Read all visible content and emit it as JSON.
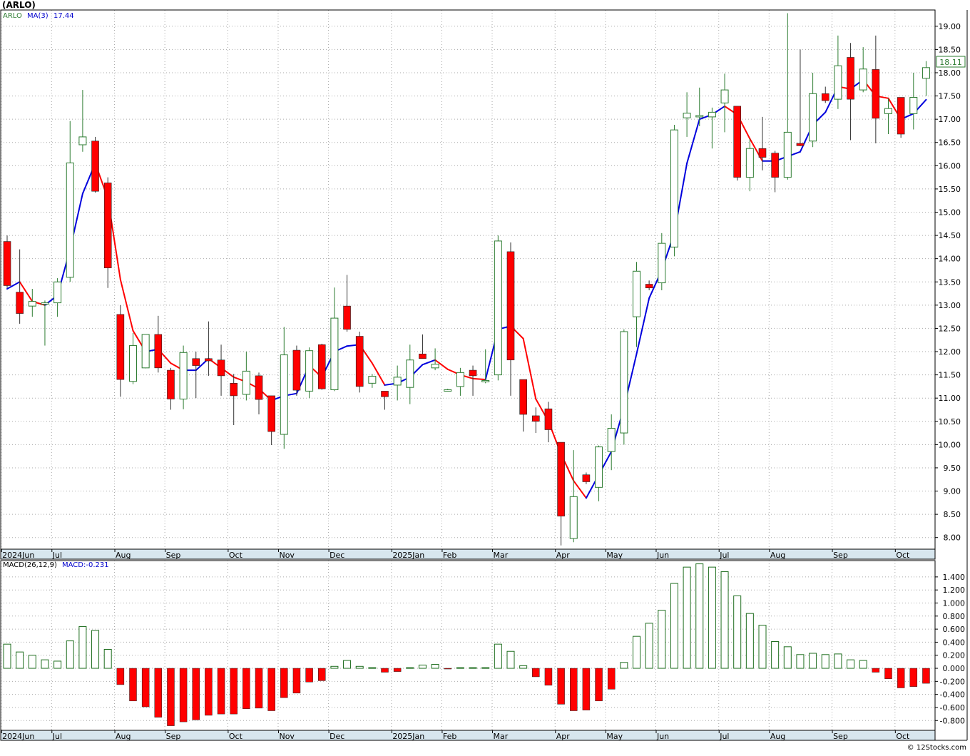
{
  "title": "(ARLO)",
  "legend": {
    "symbol": "ARLO",
    "ma_label": "MA(3)",
    "ma_value": "17.44",
    "macd_params": "MACD(26,12,9)",
    "macd_value": "MACD:-0.231"
  },
  "last_price_badge": "18.11",
  "credit": "© 12Stocks.com",
  "colors": {
    "up_candle": "#2e7d32",
    "down_candle": "#ff0000",
    "ma_up": "#0000dd",
    "ma_down": "#ff0000",
    "macd_pos": "#1f6e1f",
    "macd_neg": "#ff0000",
    "axis_band": "#d7e6ee",
    "grid": "#aaaaaa"
  },
  "chart_data": [
    {
      "type": "candlestick",
      "frequency": "weekly",
      "ylim": [
        7.75,
        19.35
      ],
      "yticks": [
        "19.00",
        "18.50",
        "18.00",
        "17.50",
        "17.00",
        "16.50",
        "16.00",
        "15.50",
        "15.00",
        "14.50",
        "14.00",
        "13.50",
        "13.00",
        "12.50",
        "12.00",
        "11.50",
        "11.00",
        "10.50",
        "10.00",
        "9.50",
        "9.00",
        "8.50",
        "8.00"
      ],
      "x_labels": [
        {
          "label": "2024Jun",
          "index": 0
        },
        {
          "label": "Jul",
          "index": 4
        },
        {
          "label": "Aug",
          "index": 9
        },
        {
          "label": "Sep",
          "index": 13
        },
        {
          "label": "Oct",
          "index": 18
        },
        {
          "label": "Nov",
          "index": 22
        },
        {
          "label": "Dec",
          "index": 26
        },
        {
          "label": "2025Jan",
          "index": 31
        },
        {
          "label": "Feb",
          "index": 35
        },
        {
          "label": "Mar",
          "index": 39
        },
        {
          "label": "Apr",
          "index": 44
        },
        {
          "label": "May",
          "index": 48
        },
        {
          "label": "Jun",
          "index": 52
        },
        {
          "label": "Jul",
          "index": 57
        },
        {
          "label": "Aug",
          "index": 61
        },
        {
          "label": "Sep",
          "index": 66
        },
        {
          "label": "Oct",
          "index": 71
        }
      ],
      "candles": [
        [
          14.37,
          14.5,
          13.37,
          13.42
        ],
        [
          13.28,
          14.2,
          12.6,
          12.82
        ],
        [
          12.98,
          13.35,
          12.75,
          13.08
        ],
        [
          13.05,
          13.1,
          12.13,
          13.05
        ],
        [
          13.05,
          13.58,
          12.75,
          13.5
        ],
        [
          13.6,
          16.96,
          13.5,
          16.06
        ],
        [
          16.45,
          17.63,
          16.3,
          16.62
        ],
        [
          16.53,
          16.62,
          15.42,
          15.45
        ],
        [
          15.63,
          15.75,
          13.37,
          13.8
        ],
        [
          12.8,
          13.0,
          11.03,
          11.4
        ],
        [
          11.36,
          12.4,
          11.3,
          12.13
        ],
        [
          11.65,
          12.35,
          11.64,
          12.37
        ],
        [
          12.37,
          12.77,
          11.55,
          11.65
        ],
        [
          11.6,
          11.65,
          10.75,
          10.98
        ],
        [
          10.98,
          12.13,
          10.76,
          11.98
        ],
        [
          11.85,
          12.0,
          11.0,
          11.7
        ],
        [
          11.85,
          12.65,
          11.48,
          11.8
        ],
        [
          11.82,
          12.15,
          11.05,
          11.48
        ],
        [
          11.32,
          11.52,
          10.42,
          11.05
        ],
        [
          11.08,
          12.0,
          10.95,
          11.58
        ],
        [
          11.48,
          11.55,
          10.65,
          10.97
        ],
        [
          11.05,
          11.05,
          9.99,
          10.28
        ],
        [
          10.22,
          12.53,
          9.91,
          11.93
        ],
        [
          12.03,
          12.13,
          11.05,
          11.17
        ],
        [
          11.15,
          12.09,
          11.0,
          12.02
        ],
        [
          12.15,
          12.17,
          11.18,
          11.2
        ],
        [
          11.18,
          13.38,
          11.15,
          12.72
        ],
        [
          12.98,
          13.65,
          12.43,
          12.48
        ],
        [
          12.33,
          12.43,
          11.12,
          11.25
        ],
        [
          11.32,
          11.52,
          11.22,
          11.47
        ],
        [
          11.15,
          11.15,
          10.75,
          11.03
        ],
        [
          11.28,
          11.7,
          10.95,
          11.45
        ],
        [
          11.23,
          12.15,
          10.87,
          11.82
        ],
        [
          11.95,
          12.37,
          11.85,
          11.85
        ],
        [
          11.65,
          12.07,
          11.6,
          11.73
        ],
        [
          11.18,
          11.2,
          11.15,
          11.18
        ],
        [
          11.25,
          11.65,
          11.05,
          11.55
        ],
        [
          11.6,
          11.7,
          11.05,
          11.48
        ],
        [
          11.38,
          12.05,
          11.32,
          11.38
        ],
        [
          11.5,
          14.5,
          11.38,
          14.38
        ],
        [
          14.15,
          14.35,
          11.05,
          11.82
        ],
        [
          11.4,
          11.4,
          10.28,
          10.65
        ],
        [
          10.62,
          10.8,
          10.25,
          10.5
        ],
        [
          10.77,
          10.92,
          10.05,
          10.32
        ],
        [
          10.05,
          10.05,
          7.83,
          8.46
        ],
        [
          7.98,
          9.88,
          7.9,
          8.88
        ],
        [
          9.35,
          9.4,
          9.15,
          9.2
        ],
        [
          9.08,
          9.98,
          8.78,
          9.95
        ],
        [
          9.85,
          10.65,
          9.45,
          10.35
        ],
        [
          10.25,
          12.48,
          10.0,
          12.43
        ],
        [
          12.75,
          13.93,
          12.1,
          13.73
        ],
        [
          13.45,
          13.53,
          13.32,
          13.37
        ],
        [
          13.48,
          14.55,
          13.32,
          14.33
        ],
        [
          14.25,
          16.88,
          14.05,
          16.77
        ],
        [
          17.03,
          17.58,
          16.62,
          17.13
        ],
        [
          17.05,
          17.68,
          16.85,
          17.08
        ],
        [
          17.05,
          17.25,
          16.37,
          17.15
        ],
        [
          17.35,
          17.98,
          16.72,
          17.63
        ],
        [
          17.28,
          17.28,
          15.68,
          15.75
        ],
        [
          15.75,
          16.58,
          15.45,
          16.37
        ],
        [
          16.37,
          17.05,
          15.9,
          16.18
        ],
        [
          16.27,
          16.32,
          15.43,
          15.75
        ],
        [
          15.75,
          19.28,
          15.7,
          16.72
        ],
        [
          16.48,
          18.5,
          16.42,
          16.43
        ],
        [
          16.53,
          18.0,
          16.4,
          17.55
        ],
        [
          17.55,
          17.7,
          17.35,
          17.4
        ],
        [
          17.43,
          18.8,
          17.22,
          18.15
        ],
        [
          18.33,
          18.64,
          16.55,
          17.43
        ],
        [
          17.63,
          18.55,
          17.58,
          18.08
        ],
        [
          18.07,
          18.8,
          16.48,
          17.02
        ],
        [
          17.12,
          17.45,
          16.68,
          17.23
        ],
        [
          17.47,
          17.47,
          16.6,
          16.68
        ],
        [
          17.12,
          18.0,
          16.78,
          17.47
        ],
        [
          17.88,
          18.25,
          17.5,
          18.11
        ]
      ],
      "ma": {
        "name": "MA(3)",
        "start_index": 0,
        "values": [
          13.35,
          13.5,
          13.08,
          13.0,
          13.21,
          14.2,
          15.4,
          16.05,
          15.3,
          13.55,
          12.45,
          12.0,
          12.05,
          11.75,
          11.6,
          11.6,
          11.85,
          11.65,
          11.45,
          11.35,
          11.2,
          10.95,
          11.05,
          11.1,
          11.7,
          11.45,
          12.0,
          12.12,
          12.15,
          11.75,
          11.28,
          11.32,
          11.45,
          11.72,
          11.82,
          11.62,
          11.5,
          11.42,
          11.4,
          12.48,
          12.55,
          12.28,
          10.98,
          10.5,
          9.8,
          9.22,
          8.85,
          9.35,
          9.85,
          10.8,
          11.95,
          13.15,
          13.75,
          14.55,
          16.05,
          17.0,
          17.1,
          17.28,
          17.1,
          16.58,
          16.1,
          16.1,
          16.2,
          16.3,
          16.88,
          17.15,
          17.7,
          17.65,
          17.85,
          17.5,
          17.45,
          17.0,
          17.12,
          17.42
        ]
      }
    },
    {
      "type": "bar",
      "name": "MACD(26,12,9)",
      "ylim": [
        -0.95,
        1.65
      ],
      "yticks": [
        "1.400",
        "1.200",
        "1.000",
        "0.800",
        "0.600",
        "0.400",
        "0.200",
        "0.000",
        "-0.200",
        "-0.400",
        "-0.600",
        "-0.800"
      ],
      "values": [
        0.37,
        0.25,
        0.2,
        0.13,
        0.11,
        0.42,
        0.64,
        0.58,
        0.29,
        -0.25,
        -0.5,
        -0.59,
        -0.75,
        -0.88,
        -0.82,
        -0.79,
        -0.72,
        -0.7,
        -0.7,
        -0.62,
        -0.61,
        -0.65,
        -0.45,
        -0.38,
        -0.21,
        -0.19,
        0.03,
        0.12,
        0.03,
        0.01,
        -0.06,
        -0.05,
        0.01,
        0.05,
        0.06,
        -0.01,
        0.01,
        0.01,
        0.01,
        0.37,
        0.26,
        0.04,
        -0.13,
        -0.26,
        -0.55,
        -0.65,
        -0.64,
        -0.5,
        -0.32,
        0.09,
        0.49,
        0.69,
        0.89,
        1.3,
        1.55,
        1.6,
        1.55,
        1.48,
        1.11,
        0.84,
        0.66,
        0.41,
        0.33,
        0.21,
        0.23,
        0.21,
        0.22,
        0.13,
        0.12,
        -0.06,
        -0.16,
        -0.3,
        -0.28,
        -0.23
      ]
    }
  ]
}
